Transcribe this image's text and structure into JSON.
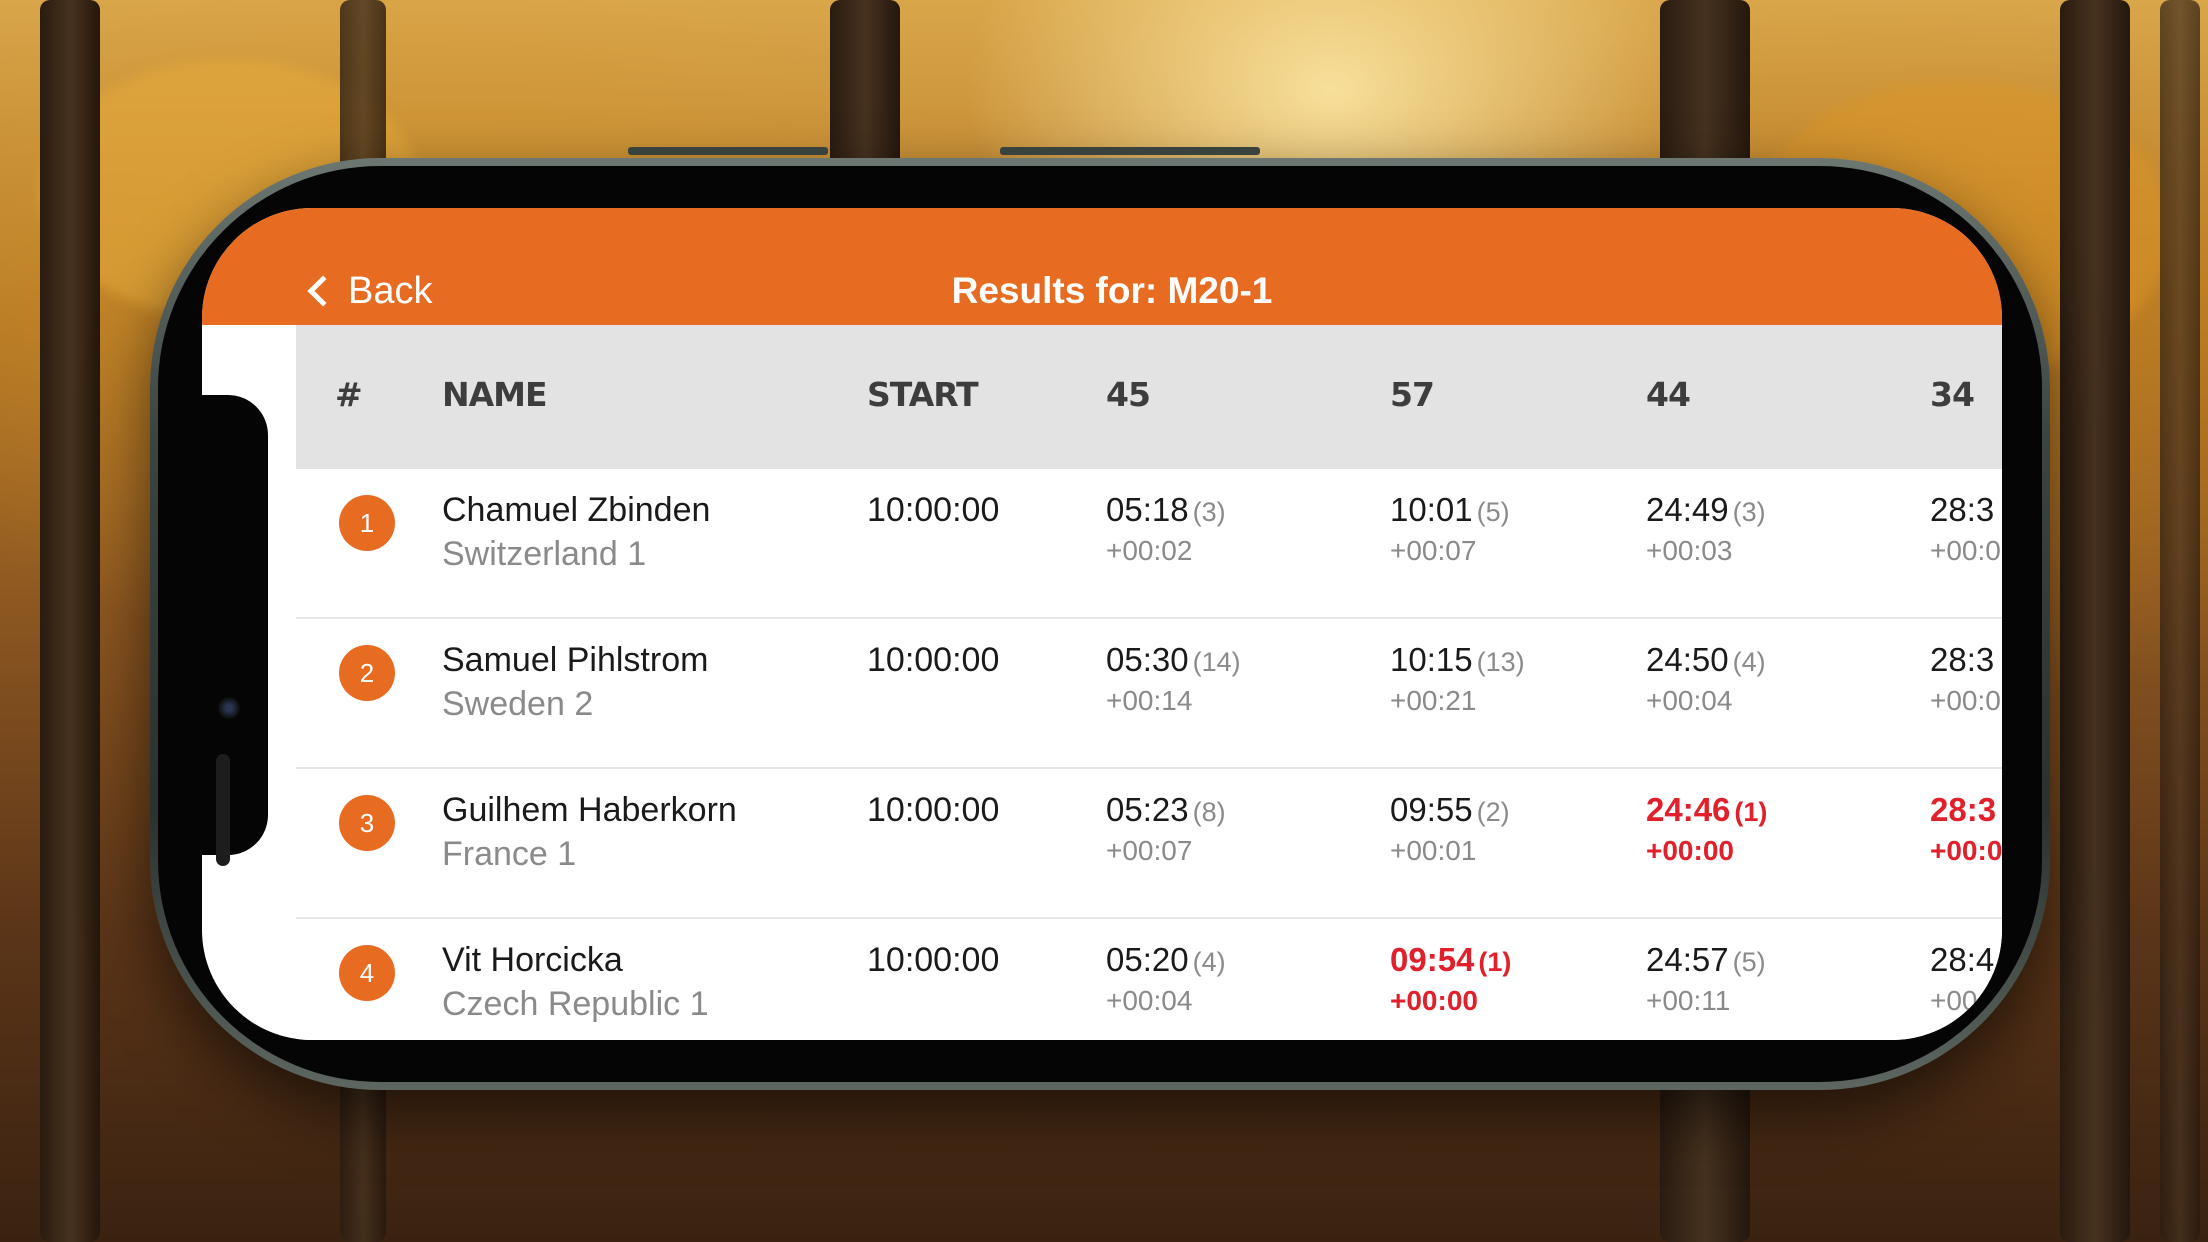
{
  "colors": {
    "accent": "#e86b22",
    "best": "#e0202a",
    "header_bg": "#e3e3e3"
  },
  "navbar": {
    "back_label": "Back",
    "title": "Results for: M20-1"
  },
  "table": {
    "columns": [
      "#",
      "NAME",
      "START",
      "45",
      "57",
      "44",
      "34"
    ],
    "rows": [
      {
        "rank": "1",
        "name": "Chamuel Zbinden",
        "team": "Switzerland 1",
        "start": "10:00:00",
        "splits": [
          {
            "time": "05:18",
            "place": "(3)",
            "diff": "+00:02",
            "best": false
          },
          {
            "time": "10:01",
            "place": "(5)",
            "diff": "+00:07",
            "best": false
          },
          {
            "time": "24:49",
            "place": "(3)",
            "diff": "+00:03",
            "best": false
          },
          {
            "time": "28:3",
            "place": "",
            "diff": "+00:0",
            "best": false
          }
        ]
      },
      {
        "rank": "2",
        "name": "Samuel Pihlstrom",
        "team": "Sweden 2",
        "start": "10:00:00",
        "splits": [
          {
            "time": "05:30",
            "place": "(14)",
            "diff": "+00:14",
            "best": false
          },
          {
            "time": "10:15",
            "place": "(13)",
            "diff": "+00:21",
            "best": false
          },
          {
            "time": "24:50",
            "place": "(4)",
            "diff": "+00:04",
            "best": false
          },
          {
            "time": "28:3",
            "place": "",
            "diff": "+00:0",
            "best": false
          }
        ]
      },
      {
        "rank": "3",
        "name": "Guilhem Haberkorn",
        "team": "France 1",
        "start": "10:00:00",
        "splits": [
          {
            "time": "05:23",
            "place": "(8)",
            "diff": "+00:07",
            "best": false
          },
          {
            "time": "09:55",
            "place": "(2)",
            "diff": "+00:01",
            "best": false
          },
          {
            "time": "24:46",
            "place": "(1)",
            "diff": "+00:00",
            "best": true
          },
          {
            "time": "28:3",
            "place": "",
            "diff": "+00:0",
            "best": true
          }
        ]
      },
      {
        "rank": "4",
        "name": "Vit Horcicka",
        "team": "Czech Republic 1",
        "start": "10:00:00",
        "splits": [
          {
            "time": "05:20",
            "place": "(4)",
            "diff": "+00:04",
            "best": false
          },
          {
            "time": "09:54",
            "place": "(1)",
            "diff": "+00:00",
            "best": true
          },
          {
            "time": "24:57",
            "place": "(5)",
            "diff": "+00:11",
            "best": false
          },
          {
            "time": "28:4",
            "place": "",
            "diff": "+00",
            "best": false
          }
        ]
      }
    ]
  }
}
